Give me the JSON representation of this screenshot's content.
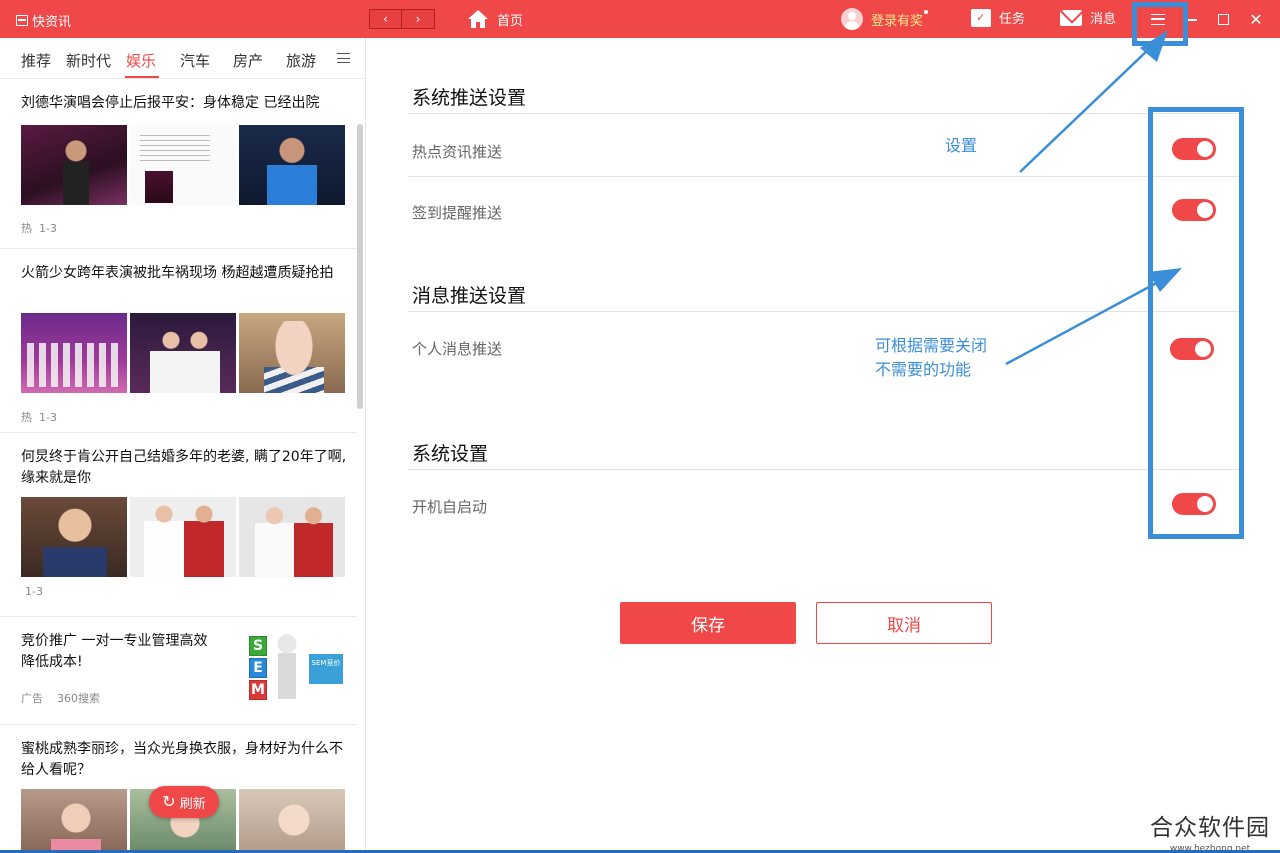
{
  "titlebar": {
    "app_title": "快资讯",
    "back_icon": "‹",
    "forward_icon": "›",
    "home_label": "首页",
    "login_label": "登录有奖",
    "task_label": "任务",
    "message_label": "消息",
    "close_glyph": "✕",
    "accent_color": "#f04848"
  },
  "tabs": [
    "推荐",
    "新时代",
    "娱乐",
    "汽车",
    "房产",
    "旅游"
  ],
  "active_tab": "娱乐",
  "news": [
    {
      "title": "刘德华演唱会停止后报平安：身体稳定 已经出院",
      "hot": "热",
      "count": "1-3"
    },
    {
      "title": "火箭少女跨年表演被批车祸现场 杨超越遭质疑抢拍",
      "hot": "热",
      "count": "1-3"
    },
    {
      "title": "何炅终于肯公开自己结婚多年的老婆, 瞒了20年了啊, 缘来就是你",
      "count": "1-3"
    },
    {
      "title": "竞价推广 一对一专业管理高效降低成本!",
      "ad": "广告",
      "source": "360搜索",
      "sem_letters": [
        "S",
        "E",
        "M"
      ],
      "sem_badge": "SEM竞价"
    },
    {
      "title": "蜜桃成熟李丽珍，当众光身换衣服，身材好为什么不给人看呢？"
    }
  ],
  "refresh_label": "刷新",
  "settings": {
    "sections": [
      {
        "title": "系统推送设置",
        "items": [
          {
            "label": "热点资讯推送",
            "enabled": true
          },
          {
            "label": "签到提醒推送",
            "enabled": true
          }
        ]
      },
      {
        "title": "消息推送设置",
        "items": [
          {
            "label": "个人消息推送",
            "enabled": true
          }
        ]
      },
      {
        "title": "系统设置",
        "items": [
          {
            "label": "开机自启动",
            "enabled": true
          }
        ]
      }
    ],
    "save_label": "保存",
    "cancel_label": "取消"
  },
  "annotations": {
    "settings_note": "设置",
    "toggle_note_line1": "可根据需要关闭",
    "toggle_note_line2": "不需要的功能",
    "color": "#3b8ed8"
  },
  "watermark": {
    "main": "合众软件园",
    "sub": "www.hezhong.net"
  }
}
